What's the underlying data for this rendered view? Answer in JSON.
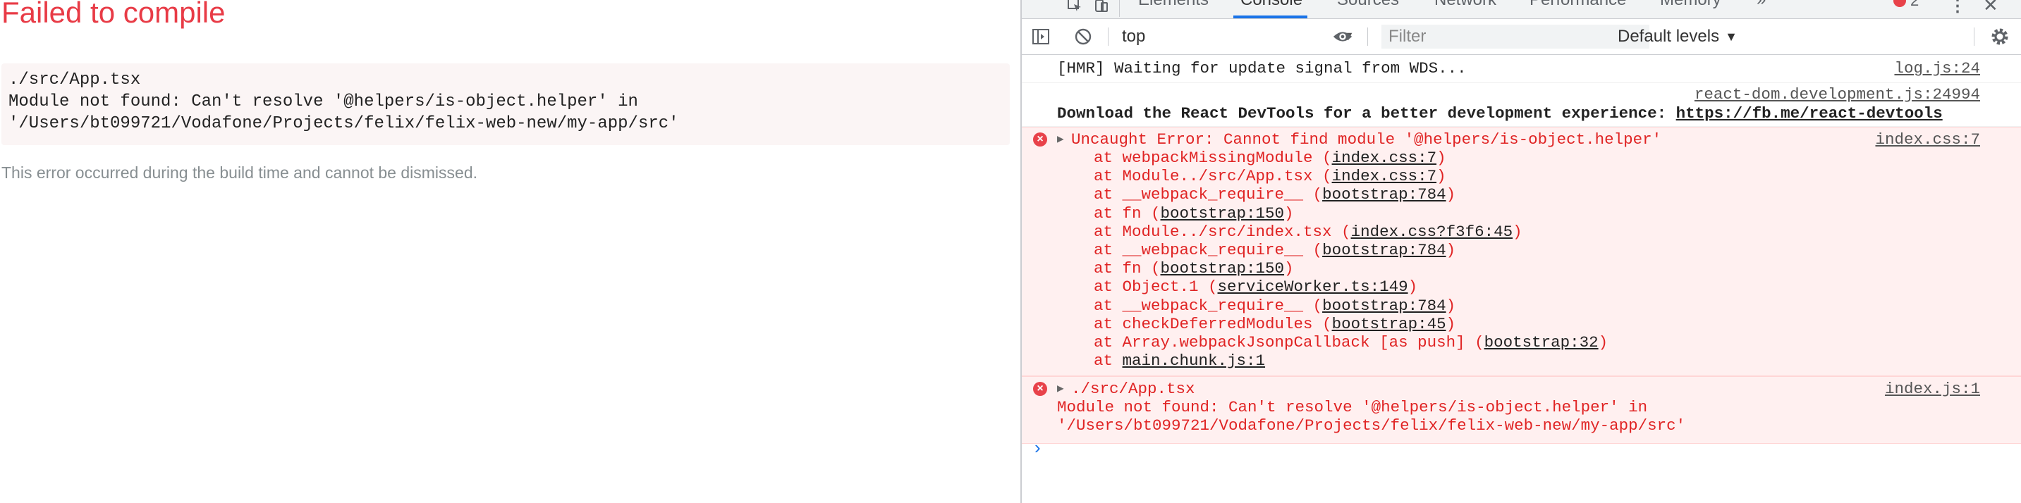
{
  "overlay": {
    "title": "Failed to compile",
    "lines": [
      "./src/App.tsx",
      "Module not found: Can't resolve '@helpers/is-object.helper' in",
      "'/Users/bt099721/Vodafone/Projects/felix/felix-web-new/my-app/src'"
    ],
    "note": "This error occurred during the build time and cannot be dismissed."
  },
  "devtools": {
    "tabs": [
      "Elements",
      "Console",
      "Sources",
      "Network",
      "Performance",
      "Memory"
    ],
    "more_tabs": "»",
    "error_count": "2",
    "toolbar": {
      "context": "top",
      "filter_placeholder": "Filter",
      "levels": "Default levels"
    },
    "messages": {
      "hmr": {
        "text": "[HMR] Waiting for update signal from WDS...",
        "source": "log.js:24"
      },
      "devtools_promo": {
        "source": "react-dom.development.js:24994",
        "text": "Download the React DevTools for a better development experience: ",
        "link": "https://fb.me/react-devtools"
      },
      "error1": {
        "source": "index.css:7",
        "headline": "Uncaught Error: Cannot find module '@helpers/is-object.helper'",
        "stack": [
          {
            "prefix": "at webpackMissingModule (",
            "link": "index.css:7",
            "suffix": ")"
          },
          {
            "prefix": "at Module../src/App.tsx (",
            "link": "index.css:7",
            "suffix": ")"
          },
          {
            "prefix": "at __webpack_require__ (",
            "link": "bootstrap:784",
            "suffix": ")"
          },
          {
            "prefix": "at fn (",
            "link": "bootstrap:150",
            "suffix": ")"
          },
          {
            "prefix": "at Module../src/index.tsx (",
            "link": "index.css?f3f6:45",
            "suffix": ")"
          },
          {
            "prefix": "at __webpack_require__ (",
            "link": "bootstrap:784",
            "suffix": ")"
          },
          {
            "prefix": "at fn (",
            "link": "bootstrap:150",
            "suffix": ")"
          },
          {
            "prefix": "at Object.1 (",
            "link": "serviceWorker.ts:149",
            "suffix": ")"
          },
          {
            "prefix": "at __webpack_require__ (",
            "link": "bootstrap:784",
            "suffix": ")"
          },
          {
            "prefix": "at checkDeferredModules (",
            "link": "bootstrap:45",
            "suffix": ")"
          },
          {
            "prefix": "at Array.webpackJsonpCallback [as push] (",
            "link": "bootstrap:32",
            "suffix": ")"
          },
          {
            "prefix": "at ",
            "link": "main.chunk.js:1",
            "suffix": ""
          }
        ]
      },
      "error2": {
        "source": "index.js:1",
        "lines": [
          "./src/App.tsx",
          "Module not found: Can't resolve '@helpers/is-object.helper' in",
          "'/Users/bt099721/Vodafone/Projects/felix/felix-web-new/my-app/src'"
        ]
      }
    }
  },
  "colors": {
    "error_red": "#e02424",
    "overlay_red": "#e83b46",
    "accent_blue": "#1a73e8"
  }
}
